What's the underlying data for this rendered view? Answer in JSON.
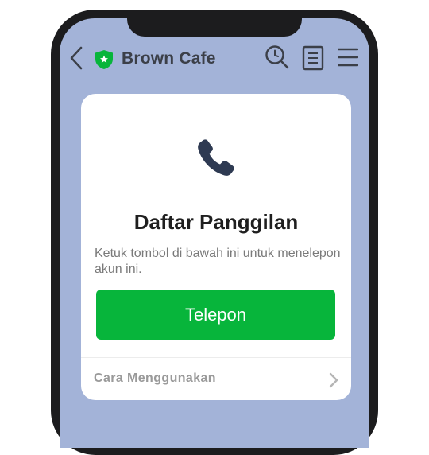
{
  "header": {
    "title": "Brown Cafe",
    "icons": [
      "back-arrow-icon",
      "verified-shield-icon",
      "search-icon",
      "notes-icon",
      "menu-icon"
    ]
  },
  "card": {
    "icon": "phone-icon",
    "title": "Daftar Panggilan",
    "description": "Ketuk tombol di bawah ini untuk menelepon akun ini.",
    "call_button_label": "Telepon",
    "howto_label": "Cara Menggunakan"
  },
  "colors": {
    "background": "#a3b3d8",
    "accent_green": "#07b53b",
    "icon_dark": "#2e3a52",
    "phone_frame": "#1c1c1e"
  }
}
